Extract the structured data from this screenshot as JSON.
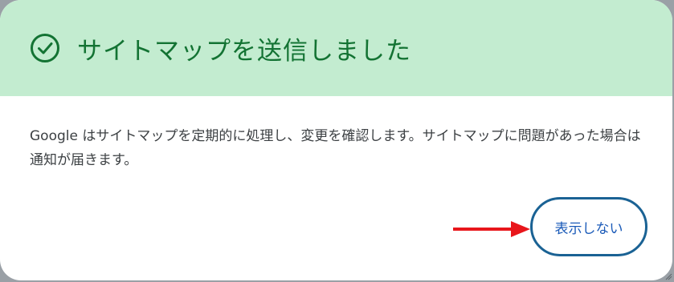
{
  "dialog": {
    "title": "サイトマップを送信しました",
    "message": "Google はサイトマップを定期的に処理し、変更を確認します。サイトマップに問題があった場合は通知が届きます。",
    "dismiss_label": "表示しない",
    "success_icon": "check-circle-icon",
    "header_color": "#c3ecd0",
    "title_color": "#137333"
  },
  "annotation": {
    "arrow_icon": "red-arrow-right",
    "arrow_color": "#e8161b",
    "highlight_color": "#1a6294"
  }
}
